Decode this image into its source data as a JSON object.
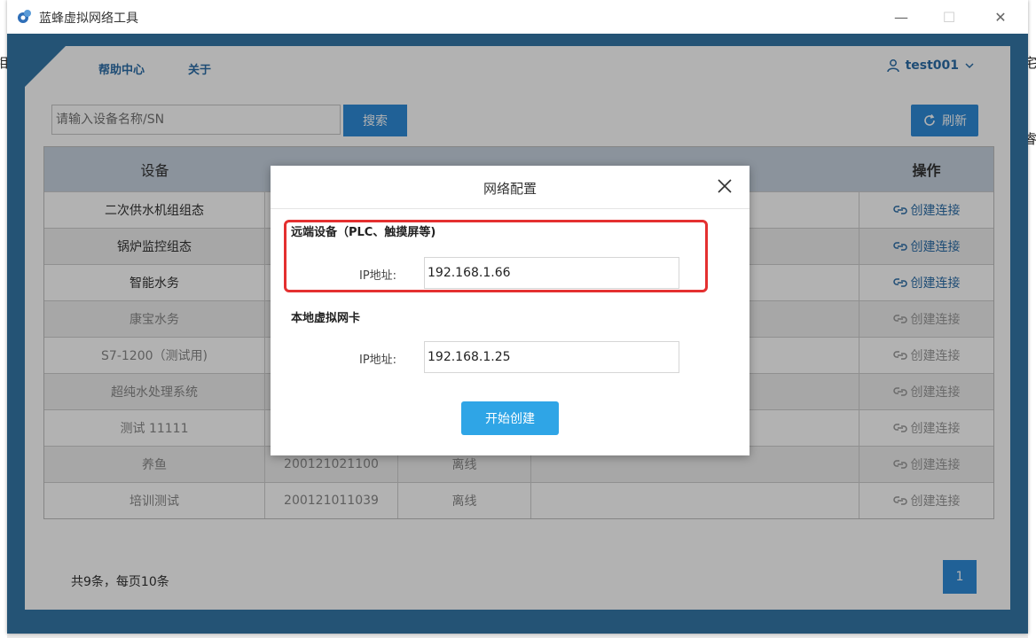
{
  "window": {
    "title": "蓝蜂虚拟网络工具",
    "minimize_glyph": "—",
    "maximize_glyph": "☐",
    "close_glyph": "✕"
  },
  "background_fragments": {
    "left_top": "相",
    "right_top": "宅",
    "right_mid": "睿"
  },
  "nav": {
    "help": "帮助中心",
    "about": "关于",
    "user": "test001"
  },
  "search": {
    "placeholder": "请输入设备名称/SN",
    "button": "搜索"
  },
  "refresh_button": "刷新",
  "table": {
    "columns": {
      "device": "设备",
      "action": "操作"
    },
    "rows": [
      {
        "device": "二次供水机组组态",
        "sn": "",
        "status": "",
        "note": "",
        "action": "创建连接",
        "enabled": true
      },
      {
        "device": "锅炉监控组态",
        "sn": "",
        "status": "",
        "note": "",
        "action": "创建连接",
        "enabled": true
      },
      {
        "device": "智能水务",
        "sn": "",
        "status": "",
        "note": "",
        "action": "创建连接",
        "enabled": true
      },
      {
        "device": "康宝水务",
        "sn": "",
        "status": "",
        "note": "",
        "action": "创建连接",
        "enabled": false
      },
      {
        "device": "S7-1200（测试用)",
        "sn": "",
        "status": "",
        "note": "",
        "action": "创建连接",
        "enabled": false
      },
      {
        "device": "超纯水处理系统",
        "sn": "",
        "status": "",
        "note": "",
        "action": "创建连接",
        "enabled": false
      },
      {
        "device": "测试 11111",
        "sn": "",
        "status": "",
        "note": "",
        "action": "创建连接",
        "enabled": false
      },
      {
        "device": "养鱼",
        "sn": "200121021100",
        "status": "离线",
        "note": "",
        "action": "创建连接",
        "enabled": false
      },
      {
        "device": "培训测试",
        "sn": "200121011039",
        "status": "离线",
        "note": "",
        "action": "创建连接",
        "enabled": false
      }
    ]
  },
  "pagination": {
    "summary": "共9条，每页10条",
    "current_page": "1"
  },
  "modal": {
    "title": "网络配置",
    "remote_section": "远端设备（PLC、触摸屏等)",
    "local_section": "本地虚拟网卡",
    "ip_label": "IP地址:",
    "remote_ip": "192.168.1.66",
    "local_ip": "192.168.1.25",
    "create_button": "开始创建"
  },
  "colors": {
    "frame": "#3478a8",
    "accent": "#2f8bd8",
    "highlight": "#e43030"
  }
}
